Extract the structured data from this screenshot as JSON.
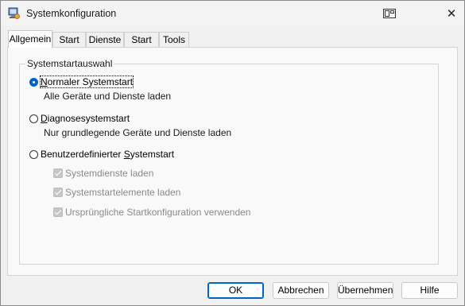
{
  "window": {
    "title": "Systemkonfiguration",
    "close_glyph": "✕"
  },
  "tabs": [
    {
      "label": "Allgemein",
      "active": true
    },
    {
      "label": "Start",
      "active": false
    },
    {
      "label": "Dienste",
      "active": false
    },
    {
      "label": "Start",
      "active": false
    },
    {
      "label": "Tools",
      "active": false
    }
  ],
  "group": {
    "title": "Systemstartauswahl",
    "options": [
      {
        "label": "Normaler Systemstart",
        "underline_char": "N",
        "description": "Alle Geräte und Dienste laden",
        "checked": true
      },
      {
        "label": "Diagnosesystemstart",
        "underline_char": "D",
        "description": "Nur grundlegende Geräte und Dienste laden",
        "checked": false
      },
      {
        "label": "Benutzerdefinierter Systemstart",
        "underline_char": "S",
        "checked": false,
        "suboptions": [
          {
            "label": "Systemdienste laden",
            "checked": true,
            "enabled": false
          },
          {
            "label": "Systemstartelemente laden",
            "checked": true,
            "enabled": false
          },
          {
            "label": "Ursprüngliche Startkonfiguration verwenden",
            "checked": true,
            "enabled": false
          }
        ]
      }
    ]
  },
  "buttons": {
    "ok": "OK",
    "cancel": "Abbrechen",
    "apply": "Übernehmen",
    "help": "Hilfe"
  },
  "colors": {
    "accent": "#0067c0",
    "disabled_text": "#8a8a8a"
  }
}
